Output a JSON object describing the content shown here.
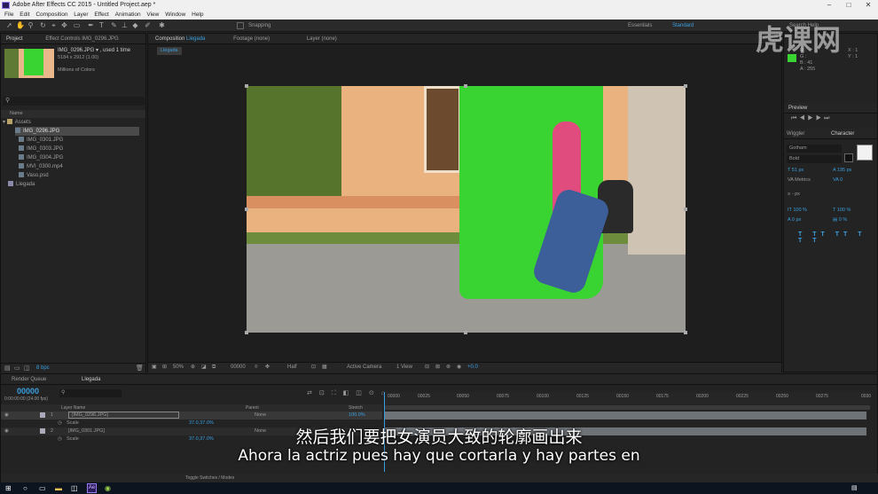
{
  "window": {
    "title": "Adobe After Effects CC 2015 - Untitled Project.aep *"
  },
  "menu": [
    "File",
    "Edit",
    "Composition",
    "Layer",
    "Effect",
    "Animation",
    "View",
    "Window",
    "Help"
  ],
  "toolbar": {
    "snapping": "Snapping",
    "workspaces": [
      "Essentials",
      "Standard"
    ],
    "search_placeholder": "Search Help"
  },
  "project_panel": {
    "tab": "Project",
    "effect_controls_tab": "Effect Controls IMG_0296.JPG",
    "thumb_name": "IMG_0296.JPG",
    "thumb_used": "used 1 time",
    "thumb_size": "5184 x 2912 (1.00)",
    "thumb_colors": "Millions of Colors",
    "col_name": "Name",
    "folder": "Assets",
    "items": [
      "IMG_0296.JPG",
      "IMG_0301.JPG",
      "IMG_0303.JPG",
      "IMG_0304.JPG",
      "MVI_0300.mp4",
      "Vaso.psd"
    ],
    "comp": "Llegada",
    "bpc": "8 bpc"
  },
  "comp_panel": {
    "tab_label": "Composition",
    "tab_comp": "Llegada",
    "footage_tab": "Footage (none)",
    "layer_tab": "Layer (none)",
    "comp_badge": "Llegada",
    "zoom": "50%",
    "timecode": "00000",
    "resolution": "Half",
    "camera": "Active Camera",
    "views": "1 View",
    "exposure": "+0.0"
  },
  "info_panel": {
    "values": [
      "R :",
      "G :",
      "B : 41",
      "A : 255"
    ],
    "xy": [
      "X : 1",
      "Y : 1"
    ],
    "preview_tab": "Preview",
    "wiggler_tab": "Wiggler",
    "character_tab": "Character",
    "font": "Gotham",
    "style": "Bold",
    "size": "51 px",
    "leading": "195 px",
    "tracking": "Metrics",
    "tsume": "0",
    "stroke": "- px",
    "vscale": "100 %",
    "hscale": "100 %",
    "baseline": "0 px",
    "tsume2": "0 %"
  },
  "timeline": {
    "render_tab": "Render Queue",
    "comp_tab": "Llegada",
    "timecode": "00000",
    "timecode_sub": "0:00:00:00 (24.00 fps)",
    "col_layer": "Layer Name",
    "col_parent": "Parent",
    "col_stretch": "Stretch",
    "layers": [
      {
        "num": "1",
        "name": "[IMG_0296.JPG]",
        "prop": "Scale",
        "scale": "37.0,37.0%",
        "parent": "None",
        "stretch": "100.0%"
      },
      {
        "num": "2",
        "name": "[IMG_0301.JPG]",
        "prop": "Scale",
        "scale": "37.0,37.0%",
        "parent": "None"
      }
    ],
    "ruler": [
      "00000",
      "00025",
      "00050",
      "00075",
      "00100",
      "00125",
      "00150",
      "00175",
      "00200",
      "00225",
      "00250",
      "00275",
      "0030"
    ],
    "toggle": "Toggle Switches / Modes"
  },
  "subtitles": {
    "zh": "然后我们要把女演员大致的轮廓画出来",
    "es": "Ahora la actriz pues hay que cortarla y hay partes en"
  },
  "watermark": "虎课网",
  "colors": {
    "green": "#39d431",
    "accent": "#3a9fe0",
    "panel": "#232323"
  }
}
